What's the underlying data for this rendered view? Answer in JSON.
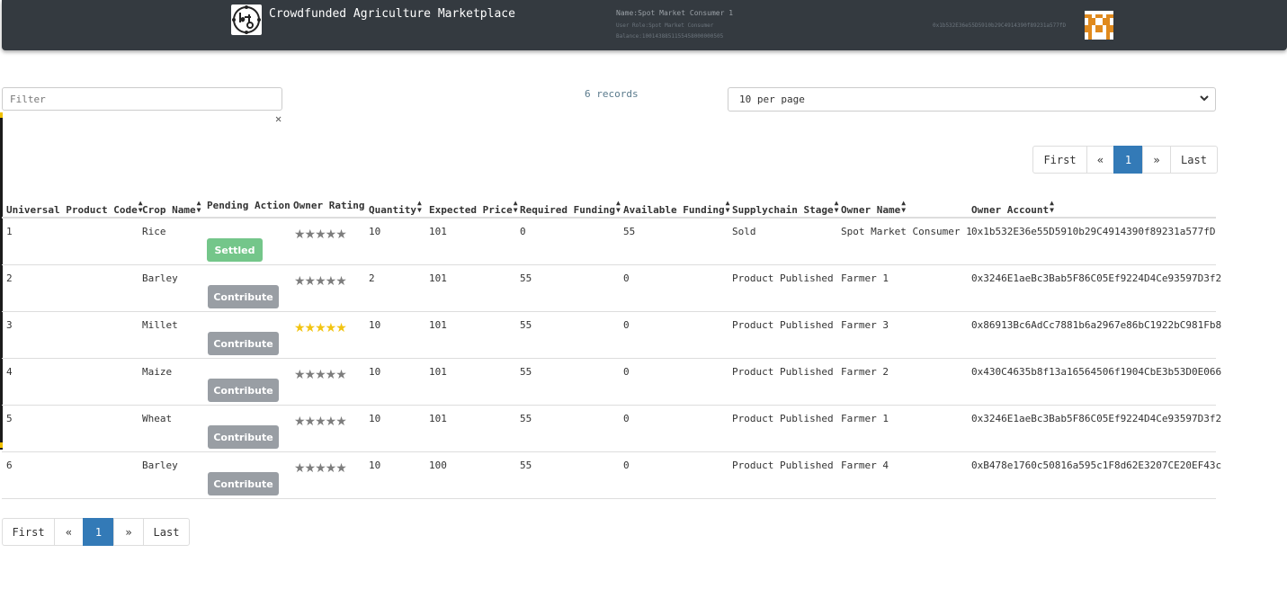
{
  "header": {
    "title": "Crowdfunded Agriculture Marketplace",
    "user_name": "Name:Spot Market Consumer 1",
    "user_role": "User Role:Spot Market Consumer",
    "balance": "Balance:1001438851155458000000505",
    "account": "0x1b532E36e55D5910b29C4914390f89231a577fD"
  },
  "controls": {
    "filter_placeholder": "Filter",
    "clear_glyph": "✕",
    "record_count": "6 records",
    "page_size": "10 per page"
  },
  "pagination": {
    "first": "First",
    "prev": "«",
    "current": "1",
    "next": "»",
    "last": "Last"
  },
  "table": {
    "columns": [
      {
        "label": "Universal Product Code",
        "sortable": true
      },
      {
        "label": "Crop Name",
        "sortable": true
      },
      {
        "label": "Pending Action",
        "sortable": false
      },
      {
        "label": "Owner Rating",
        "sortable": false
      },
      {
        "label": "Quantity",
        "sortable": true
      },
      {
        "label": "Expected Price",
        "sortable": true
      },
      {
        "label": "Required Funding",
        "sortable": true
      },
      {
        "label": "Available Funding",
        "sortable": true
      },
      {
        "label": "Supplychain Stage",
        "sortable": true
      },
      {
        "label": "Owner Name",
        "sortable": true
      },
      {
        "label": "Owner Account",
        "sortable": true
      }
    ],
    "rows": [
      {
        "upc": "1",
        "crop": "Rice",
        "action": "Settled",
        "rating": "★★★★★",
        "rating_color": "#7d7d7d",
        "quantity": "10",
        "price": "101",
        "required": "0",
        "available": "55",
        "stage": "Sold",
        "owner": "Spot Market Consumer 1",
        "account": "0x1b532E36e55D5910b29C4914390f89231a577fD"
      },
      {
        "upc": "2",
        "crop": "Barley",
        "action": "Contribute",
        "rating": "★★★★★",
        "rating_color": "#7d7d7d",
        "quantity": "2",
        "price": "101",
        "required": "55",
        "available": "0",
        "stage": "Product Published",
        "owner": "Farmer 1",
        "account": "0x3246E1aeBc3Bab5F86C05Ef9224D4Ce93597D3f2"
      },
      {
        "upc": "3",
        "crop": "Millet",
        "action": "Contribute",
        "rating": "★★★★★",
        "rating_color": "#f2c412",
        "quantity": "10",
        "price": "101",
        "required": "55",
        "available": "0",
        "stage": "Product Published",
        "owner": "Farmer 3",
        "account": "0x86913Bc6AdCc7881b6a2967e86bC1922bC981Fb8"
      },
      {
        "upc": "4",
        "crop": "Maize",
        "action": "Contribute",
        "rating": "★★★★★",
        "rating_color": "#7d7d7d",
        "quantity": "10",
        "price": "101",
        "required": "55",
        "available": "0",
        "stage": "Product Published",
        "owner": "Farmer 2",
        "account": "0x430C4635b8f13a16564506f1904CbE3b53D0E066"
      },
      {
        "upc": "5",
        "crop": "Wheat",
        "action": "Contribute",
        "rating": "★★★★★",
        "rating_color": "#7d7d7d",
        "quantity": "10",
        "price": "101",
        "required": "55",
        "available": "0",
        "stage": "Product Published",
        "owner": "Farmer 1",
        "account": "0x3246E1aeBc3Bab5F86C05Ef9224D4Ce93597D3f2"
      },
      {
        "upc": "6",
        "crop": "Barley",
        "action": "Contribute",
        "rating": "★★★★★",
        "rating_color": "#7d7d7d",
        "quantity": "10",
        "price": "100",
        "required": "55",
        "available": "0",
        "stage": "Product Published",
        "owner": "Farmer 4",
        "account": "0xB478e1760c50816a595c1F8d62E3207CE20EF43c"
      }
    ]
  }
}
